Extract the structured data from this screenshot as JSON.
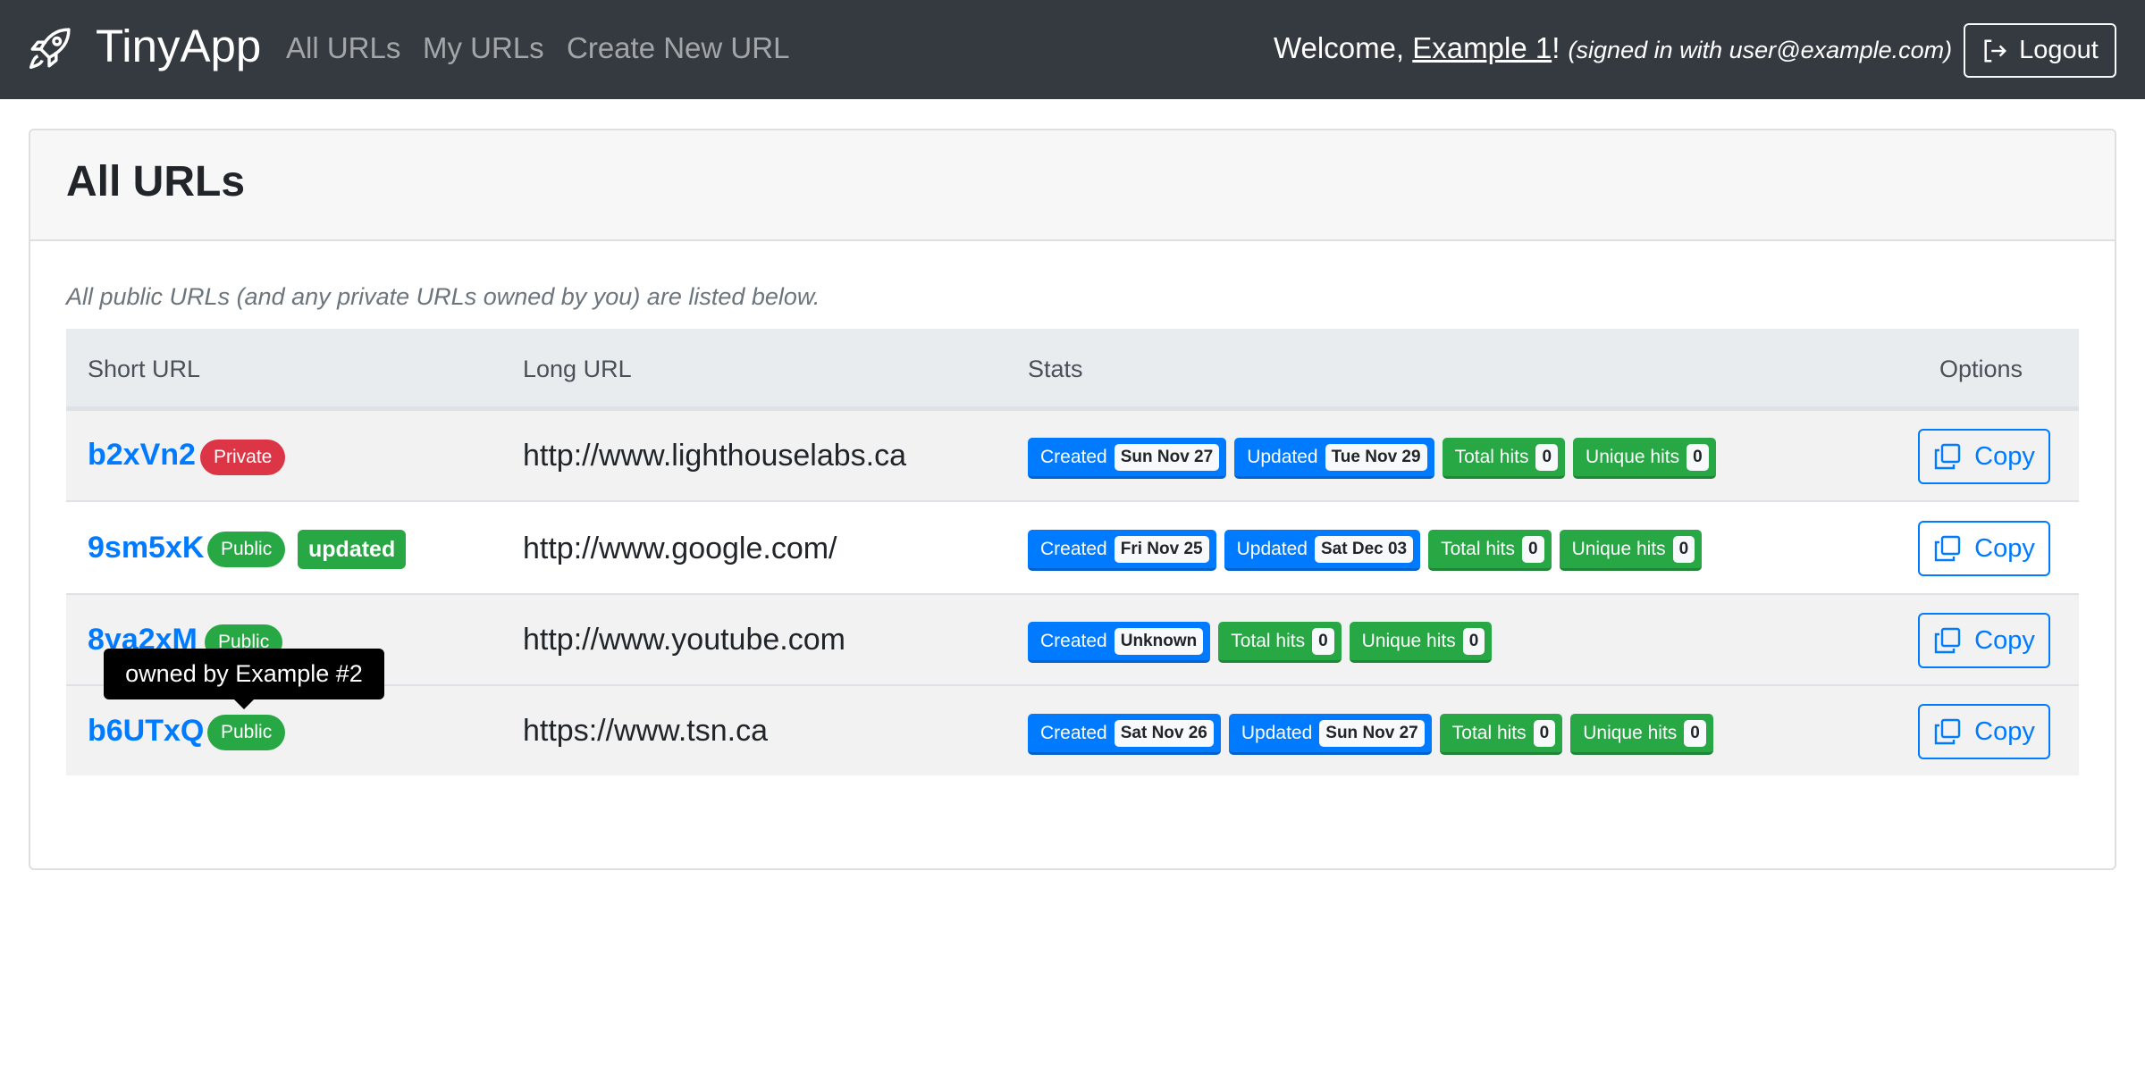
{
  "navbar": {
    "brand": "TinyApp",
    "links": [
      "All URLs",
      "My URLs",
      "Create New URL"
    ],
    "welcome_prefix": "Welcome,",
    "user_name": "Example 1",
    "welcome_suffix": "!",
    "signed_in_note": "(signed in with user@example.com)",
    "logout_label": "Logout"
  },
  "page": {
    "title": "All URLs",
    "subtitle": "All public URLs (and any private URLs owned by you) are listed below."
  },
  "table": {
    "headers": [
      "Short URL",
      "Long URL",
      "Stats",
      "Options"
    ],
    "copy_label": "Copy",
    "stat_labels": {
      "created": "Created",
      "updated": "Updated",
      "total": "Total hits",
      "unique": "Unique hits"
    },
    "rows": [
      {
        "short": "b2xVn2",
        "badge": "Private",
        "tag": "",
        "long": "http://www.lighthouselabs.ca",
        "created": "Sun Nov 27",
        "updated": "Tue Nov 29",
        "total": "0",
        "unique": "0"
      },
      {
        "short": "9sm5xK",
        "badge": "Public",
        "tag": "updated",
        "long": "http://www.google.com/",
        "created": "Fri Nov 25",
        "updated": "Sat Dec 03",
        "total": "0",
        "unique": "0"
      },
      {
        "short": "8ya2xM",
        "badge": "Public",
        "tag": "",
        "long": "http://www.youtube.com",
        "created": "Unknown",
        "updated": "",
        "total": "0",
        "unique": "0"
      },
      {
        "short": "b6UTxQ",
        "badge": "Public",
        "tag": "",
        "long": "https://www.tsn.ca",
        "created": "Sat Nov 26",
        "updated": "Sun Nov 27",
        "total": "0",
        "unique": "0"
      }
    ]
  },
  "tooltip": "owned by Example #2",
  "colors": {
    "navbar": "#343a40",
    "primary": "#007bff",
    "success": "#28a745",
    "danger": "#dc3545"
  }
}
